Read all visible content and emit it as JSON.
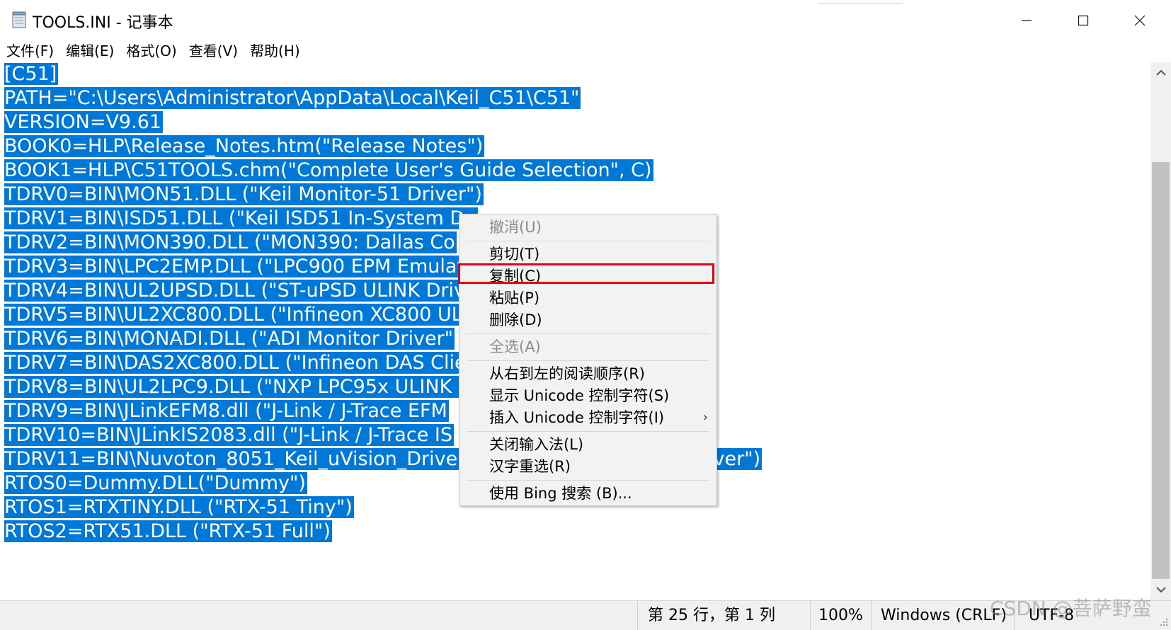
{
  "window": {
    "title": "TOOLS.INI - 记事本"
  },
  "menu": [
    "文件(F)",
    "编辑(E)",
    "格式(O)",
    "查看(V)",
    "帮助(H)"
  ],
  "editor": {
    "lines": [
      "[C51]",
      "PATH=\"C:\\Users\\Administrator\\AppData\\Local\\Keil_C51\\C51\"",
      "VERSION=V9.61",
      "BOOK0=HLP\\Release_Notes.htm(\"Release Notes\")",
      "BOOK1=HLP\\C51TOOLS.chm(\"Complete User's Guide Selection\", C)",
      "TDRV0=BIN\\MON51.DLL (\"Keil Monitor-51 Driver\")",
      "TDRV1=BIN\\ISD51.DLL (\"Keil ISD51 In-System De",
      "TDRV2=BIN\\MON390.DLL (\"MON390: Dallas Co",
      "TDRV3=BIN\\LPC2EMP.DLL (\"LPC900 EPM Emulat",
      "TDRV4=BIN\\UL2UPSD.DLL (\"ST-uPSD ULINK Driv",
      "TDRV5=BIN\\UL2XC800.DLL (\"Infineon XC800 UL",
      "TDRV6=BIN\\MONADI.DLL (\"ADI Monitor Driver\"",
      "TDRV7=BIN\\DAS2XC800.DLL (\"Infineon DAS Clie",
      "TDRV8=BIN\\UL2LPC9.DLL (\"NXP LPC95x ULINK I",
      "TDRV9=BIN\\JLinkEFM8.dll (\"J-Link / J-Trace EFM",
      "TDRV10=BIN\\JLinkIS2083.dll (\"J-Link / J-Trace IS",
      "TDRV11=BIN\\Nuvoton_8051_Keil_uVision_Drive",
      "RTOS0=Dummy.DLL(\"Dummy\")",
      "RTOS1=RTXTINY.DLL (\"RTX-51 Tiny\")",
      "RTOS2=RTX51.DLL (\"RTX-51 Full\")"
    ],
    "tail_fragment": "iver\")"
  },
  "context_menu": {
    "items": [
      {
        "label": "撤消(U)",
        "disabled": true
      },
      {
        "label": "剪切(T)",
        "disabled": false
      },
      {
        "label": "复制(C)",
        "disabled": false,
        "highlighted": true
      },
      {
        "label": "粘贴(P)",
        "disabled": false
      },
      {
        "label": "删除(D)",
        "disabled": false
      },
      {
        "label": "全选(A)",
        "disabled": true
      },
      {
        "label": "从右到左的阅读顺序(R)",
        "disabled": false
      },
      {
        "label": "显示 Unicode 控制字符(S)",
        "disabled": false
      },
      {
        "label": "插入 Unicode 控制字符(I)",
        "disabled": false,
        "submenu": true
      },
      {
        "label": "关闭输入法(L)",
        "disabled": false
      },
      {
        "label": "汉字重选(R)",
        "disabled": false
      },
      {
        "label": "使用 Bing 搜索 (B)...",
        "disabled": false
      }
    ],
    "submenu_arrow": "›",
    "highlight_color": "#e60012"
  },
  "statusbar": {
    "position": "第 25 行，第 1 列",
    "zoom": "100%",
    "line_ending": "Windows (CRLF)",
    "encoding": "UTF-8"
  },
  "watermark": "CSDN @菩萨野蛮",
  "colors": {
    "selection": "#0078d7",
    "statusbar_bg": "#f0f0f0",
    "menu_bg": "#f2f2f2"
  }
}
